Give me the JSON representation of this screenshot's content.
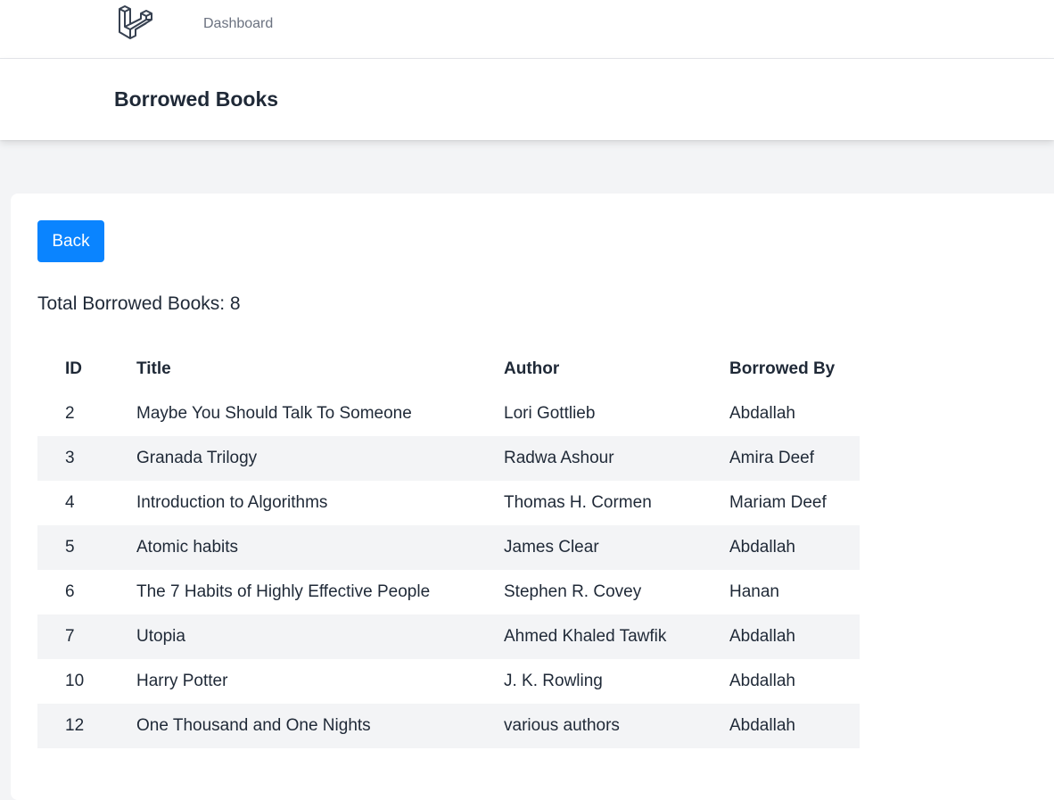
{
  "nav": {
    "logo_icon": "laravel-logo-icon",
    "dashboard_label": "Dashboard"
  },
  "header": {
    "title": "Borrowed Books"
  },
  "content": {
    "back_label": "Back",
    "total_text": "Total Borrowed Books: 8",
    "table": {
      "headers": [
        "ID",
        "Title",
        "Author",
        "Borrowed By"
      ],
      "rows": [
        [
          "2",
          "Maybe You Should Talk To Someone",
          "Lori Gottlieb",
          "Abdallah"
        ],
        [
          "3",
          "Granada Trilogy",
          "Radwa Ashour",
          "Amira Deef"
        ],
        [
          "4",
          "Introduction to Algorithms",
          "Thomas H. Cormen",
          "Mariam Deef"
        ],
        [
          "5",
          "Atomic habits",
          "James Clear",
          "Abdallah"
        ],
        [
          "6",
          "The 7 Habits of Highly Effective People",
          "Stephen R. Covey",
          "Hanan"
        ],
        [
          "7",
          "Utopia",
          "Ahmed Khaled Tawfik",
          "Abdallah"
        ],
        [
          "10",
          "Harry Potter",
          "J. K. Rowling",
          "Abdallah"
        ],
        [
          "12",
          "One Thousand and One Nights",
          "various authors",
          "Abdallah"
        ]
      ]
    }
  },
  "colors": {
    "primary_button": "#0a84ff",
    "stripe_row": "#f3f4f6",
    "page_background": "#f3f4f6"
  }
}
